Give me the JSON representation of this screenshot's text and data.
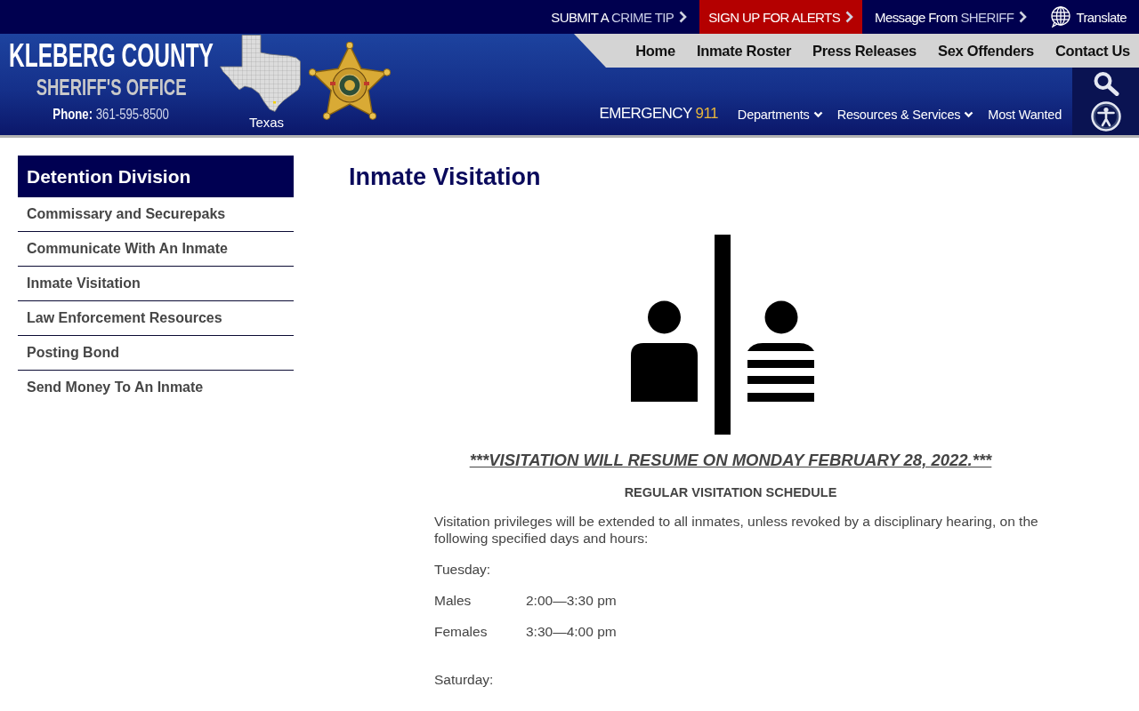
{
  "top_bar": {
    "links": [
      {
        "lead": "SUBMIT A",
        "accent": "CRIME TIP",
        "highlighted": false
      },
      {
        "lead": "SIGN UP FOR ALERTS",
        "highlighted": true
      },
      {
        "lead": "Message From",
        "accent": "SHERIFF",
        "highlighted": false
      }
    ],
    "translate": {
      "label": "Translate"
    }
  },
  "header": {
    "logo": {
      "title": "KLEBERG COUNTY",
      "subtitle": "SHERIFF'S OFFICE",
      "phone_label": "Phone:",
      "phone_number": "361-595-8500"
    },
    "map_label": "Texas"
  },
  "main_nav": [
    "Home",
    "Inmate Roster",
    "Press Releases",
    "Sex Offenders",
    "Contact Us"
  ],
  "secondary_nav": {
    "emergency": {
      "label": "EMERGENCY",
      "number": "911"
    },
    "items": [
      {
        "label": "Departments",
        "dropdown": true
      },
      {
        "label": "Resources & Services",
        "dropdown": true
      },
      {
        "label": "Most Wanted",
        "dropdown": false
      }
    ]
  },
  "sidebar": {
    "title": "Detention Division",
    "items": [
      "Commissary and Securepaks",
      "Communicate With An Inmate",
      "Inmate Visitation",
      "Law Enforcement Resources",
      "Posting Bond",
      "Send Money To An Inmate"
    ]
  },
  "content": {
    "title": "Inmate Visitation",
    "notice": "***VISITATION WILL RESUME ON MONDAY FEBRUARY 28, 2022.***",
    "schedule_heading": "REGULAR VISITATION SCHEDULE",
    "intro": "Visitation privileges will be extended to all inmates, unless revoked by a disciplinary hearing, on the following specified days and hours:",
    "days": [
      {
        "day": "Tuesday:",
        "slots": [
          {
            "group": "Males",
            "time": "2:00—3:30 pm"
          },
          {
            "group": "Females",
            "time": "3:30—4:00 pm"
          }
        ]
      },
      {
        "day": "Saturday:"
      }
    ]
  }
}
